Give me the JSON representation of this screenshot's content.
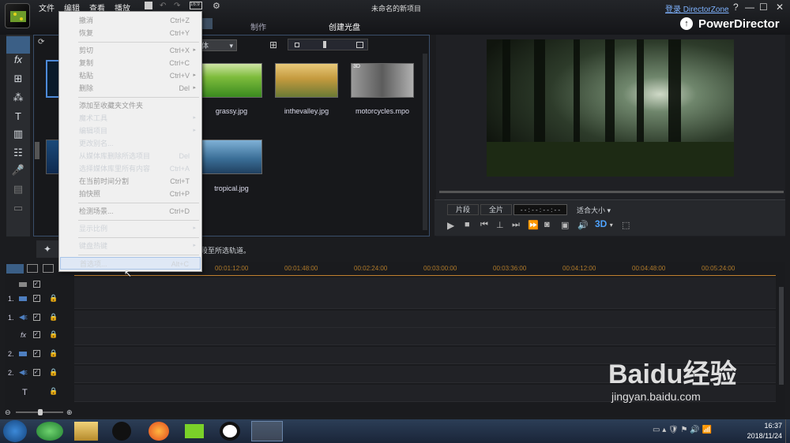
{
  "app": {
    "title": "未命名的新项目",
    "brand": "PowerDirector",
    "login": "登录 DirectorZone",
    "win_help": "?",
    "win_min": "—",
    "win_max": "☐",
    "win_close": "✕"
  },
  "menubar": [
    "文件",
    "编辑",
    "查看",
    "播放"
  ],
  "top_tabs": {
    "produce": "制作",
    "create_disc": "创建光盘"
  },
  "library": {
    "filter": "体",
    "items": [
      {
        "label": "grassy.jpg",
        "color": "#6bb03a"
      },
      {
        "label": "inthevalley.jpg",
        "color": "#c49a3e"
      },
      {
        "label": "motorcycles.mpo",
        "color": "#8a8a8a",
        "badge": "3D"
      },
      {
        "label": "tropical.jpg",
        "color": "#3b6f98"
      }
    ]
  },
  "hint": "段至所选轨道。",
  "preview": {
    "clip": "片段",
    "full": "全片",
    "timecode": "- - : - - : - - : - -",
    "fit": "适合大小",
    "mode3d": "3D"
  },
  "timeline": {
    "ticks": [
      "00:01:12:00",
      "00:01:48:00",
      "00:02:24:00",
      "00:03:00:00",
      "00:03:36:00",
      "00:04:12:00",
      "00:04:48:00",
      "00:05:24:00"
    ],
    "tracks": [
      "1.",
      "1.",
      "fx",
      "2.",
      "2.",
      "T",
      ""
    ]
  },
  "menu": {
    "items": [
      {
        "label": "撤消",
        "shortcut": "Ctrl+Z",
        "disabled": true
      },
      {
        "label": "恢复",
        "shortcut": "Ctrl+Y",
        "disabled": true
      },
      {
        "label": "剪切",
        "shortcut": "Ctrl+X",
        "disabled": true,
        "arrow": "▸"
      },
      {
        "label": "复制",
        "shortcut": "Ctrl+C",
        "disabled": true
      },
      {
        "label": "粘贴",
        "shortcut": "Ctrl+V",
        "disabled": true,
        "arrow": "▸"
      },
      {
        "label": "删除",
        "shortcut": "Del",
        "disabled": true,
        "arrow": "▸"
      },
      {
        "label": "添加至收藏夹文件夹",
        "shortcut": "",
        "disabled": true
      },
      {
        "label": "魔术工具",
        "shortcut": "",
        "arrow": "▸"
      },
      {
        "label": "编辑项目",
        "shortcut": "",
        "arrow": "▸"
      },
      {
        "label": "更改别名...",
        "shortcut": ""
      },
      {
        "label": "从媒体库删除所选项目",
        "shortcut": "Del"
      },
      {
        "label": "选择媒体库里所有内容",
        "shortcut": "Ctrl+A"
      },
      {
        "label": "在当前时间分割",
        "shortcut": "Ctrl+T",
        "disabled": true
      },
      {
        "label": "拍快照",
        "shortcut": "Ctrl+P",
        "disabled": true
      },
      {
        "label": "检测场景...",
        "shortcut": "Ctrl+D",
        "disabled": true
      },
      {
        "label": "显示比例",
        "shortcut": "",
        "arrow": "▸"
      },
      {
        "label": "键盘热键",
        "shortcut": "",
        "arrow": "▸"
      },
      {
        "label": "首选项...",
        "shortcut": "Alt+C",
        "highlight": true
      }
    ]
  },
  "taskbar": {
    "time": "16:37",
    "date": "2018/11/24"
  },
  "watermark": {
    "text": "Baidu经验",
    "url": "jingyan.baidu.com"
  }
}
